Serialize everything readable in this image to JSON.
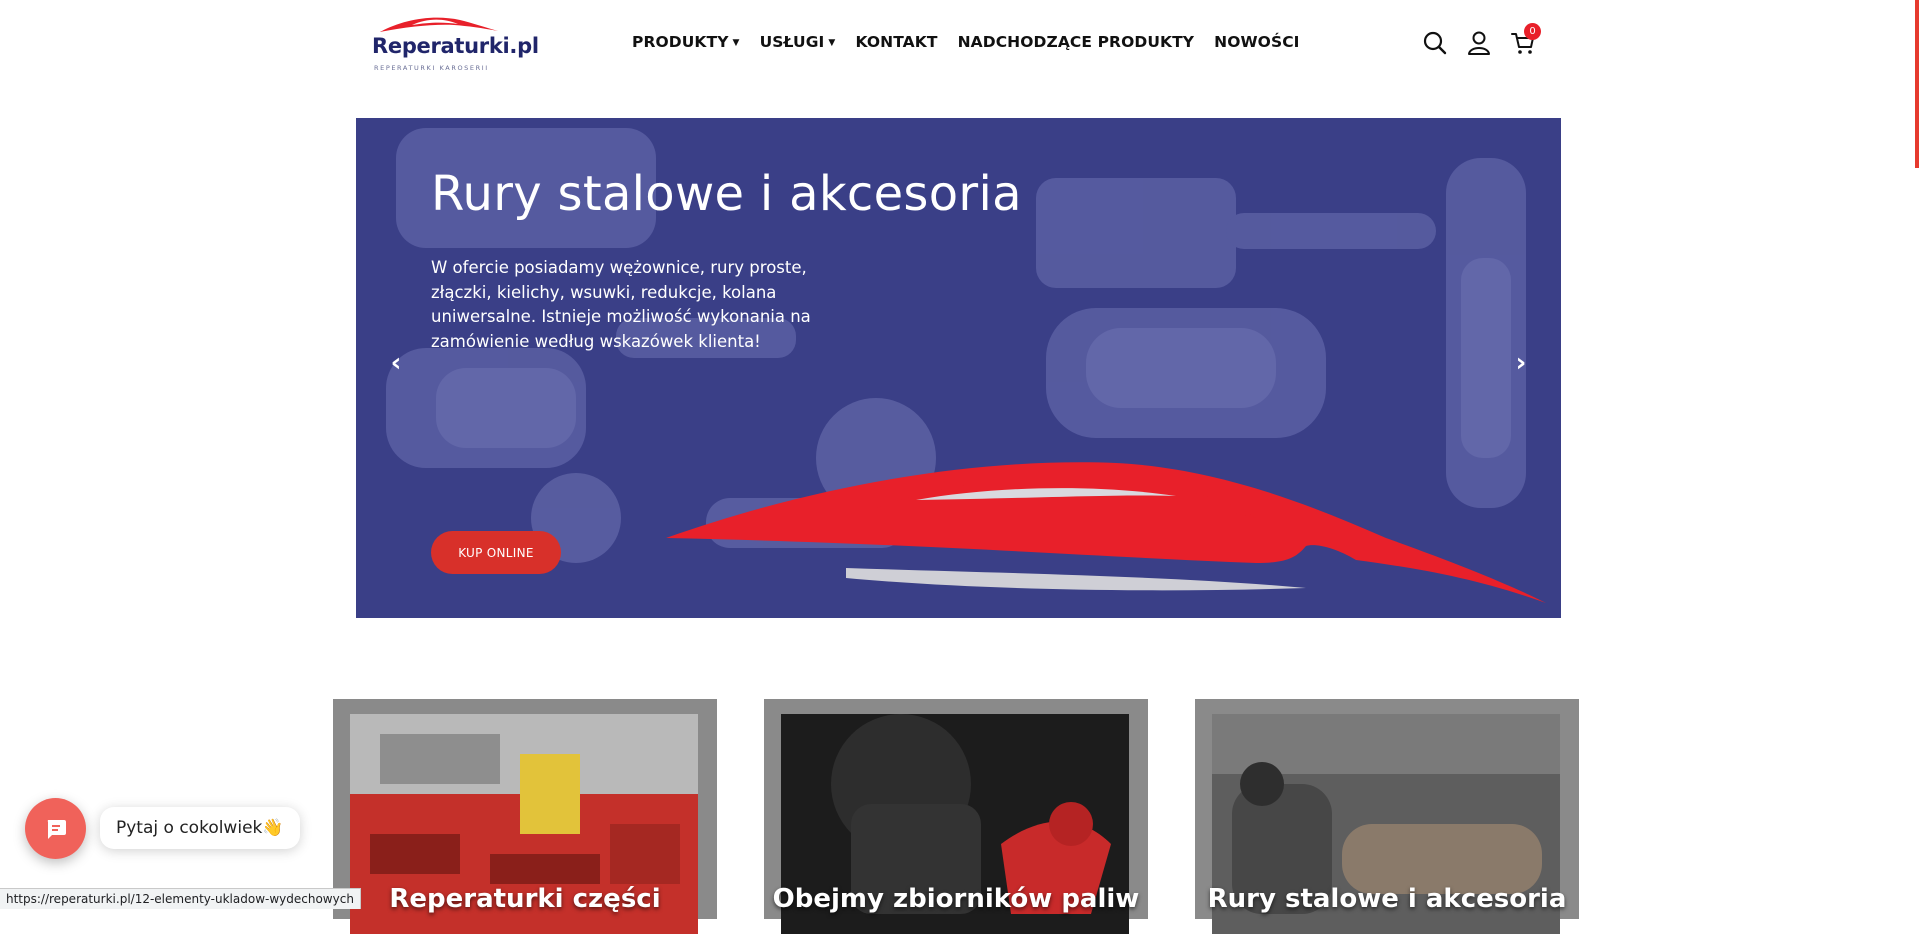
{
  "header": {
    "logo": {
      "text": "Reperaturki.pl",
      "subtitle": "REPERATURKI KAROSERII"
    },
    "nav": [
      {
        "label": "PRODUKTY",
        "dropdown": true
      },
      {
        "label": "USŁUGI",
        "dropdown": true
      },
      {
        "label": "KONTAKT",
        "dropdown": false
      },
      {
        "label": "NADCHODZĄCE PRODUKTY",
        "dropdown": false
      },
      {
        "label": "NOWOŚCI",
        "dropdown": false
      }
    ],
    "icons": [
      "search-icon",
      "user-icon",
      "cart-icon"
    ],
    "cart_count": "0"
  },
  "hero": {
    "title": "Rury stalowe i akcesoria",
    "description": "W ofercie posiadamy wężownice, rury proste, złączki, kielichy, wsuwki, redukcje, kolana uniwersalne. Istnieje możliwość wykonania na zamówienie według wskazówek klienta!",
    "button_label": "KUP ONLINE",
    "prev_arrow": "‹",
    "next_arrow": "›"
  },
  "categories": [
    {
      "title": "Reperaturki części"
    },
    {
      "title": "Obejmy zbiorników paliw"
    },
    {
      "title": "Rury stalowe i akcesoria"
    }
  ],
  "chat": {
    "prompt": "Pytaj o cokolwiek👋"
  },
  "status_bar": {
    "url": "https://reperaturki.pl/12-elementy-ukladow-wydechowych"
  },
  "colors": {
    "brand_navy": "#20256a",
    "accent_red": "#e8202a",
    "hero_overlay": "#3a3f87",
    "button_red": "#d8302a",
    "chat_coral": "#f0625a"
  }
}
